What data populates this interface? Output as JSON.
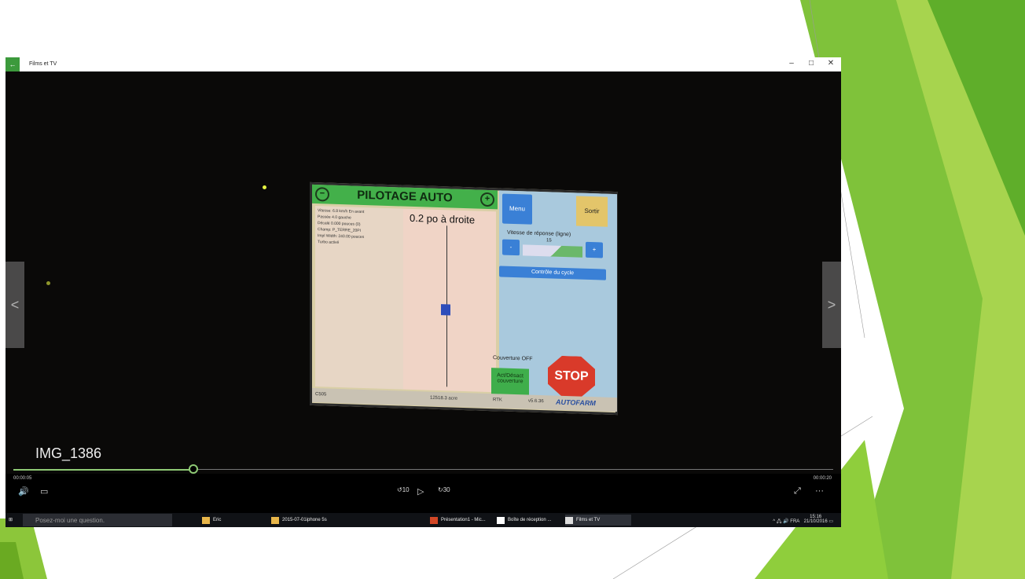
{
  "app": {
    "window_title": "Films et TV",
    "back_icon": "back-arrow-icon",
    "minimize_glyph": "–",
    "restore_glyph": "□",
    "close_glyph": "✕"
  },
  "video": {
    "title": "IMG_1386",
    "current_time": "00:00:05",
    "total_time": "00:00:20",
    "progress": 0.22,
    "prev_arrow": "<",
    "next_arrow": ">"
  },
  "controls": {
    "volume_icon": "🔊",
    "subtitles_icon": "▭",
    "skip_back_label": "10",
    "play_icon": "▷",
    "skip_fwd_label": "30",
    "fullscreen_icon": "⤢",
    "more_icon": "···"
  },
  "screen": {
    "header": "PILOTAGE AUTO",
    "zoom_out": "−",
    "zoom_in": "+",
    "left_lines": [
      "Vitesse: 6.8 km/h En avant",
      "Passée 4.0 gauche",
      "Décalé 0.000 pouces (0)",
      "Champ: P_TERRE_20PI",
      "Impl Width: 240.00 pouces",
      "Turbo activé"
    ],
    "deviation": "0.2 po à droite",
    "menu": "Menu",
    "sortir": "Sortir",
    "vitesse_label": "Vitesse de réponse (ligne)",
    "vitesse_value": "15",
    "minus": "-",
    "plus": "+",
    "cycle": "Contrôle du cycle",
    "couverture": "Couverture OFF",
    "act_desact": "Act/Désact couverture",
    "stop": "STOP",
    "footer_left": "C505",
    "footer_area": "12518.3 acre",
    "footer_rtk": "RTK",
    "footer_version": "v5.6.36",
    "brand": "AUTOFARM"
  },
  "taskbar": {
    "search_placeholder": "Posez-moi une question.",
    "items": [
      "Eric",
      "2015-07-01iphone 5s",
      "Présentation1 - Mic...",
      "Boîte de réception ...",
      "Films et TV"
    ],
    "language": "FRA",
    "time": "15:16",
    "date": "21/10/2016",
    "tray_icons": "^ 🖧 🔊"
  },
  "colors": {
    "accent_green": "#8ec975",
    "header_green": "#43b04a",
    "stop_red": "#d93a2a"
  }
}
